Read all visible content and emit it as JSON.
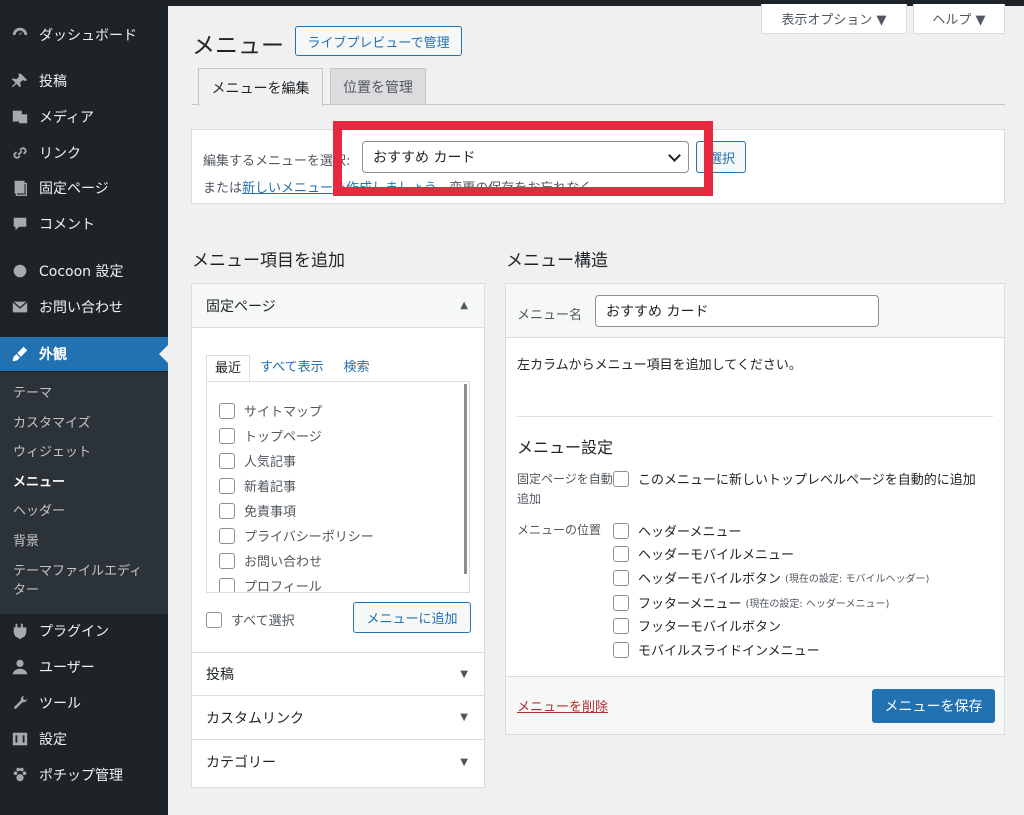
{
  "sidebar": {
    "items": [
      {
        "label": "ダッシュボード",
        "icon": "dashboard-icon"
      },
      {
        "label": "投稿",
        "icon": "pin-icon"
      },
      {
        "label": "メディア",
        "icon": "media-icon"
      },
      {
        "label": "リンク",
        "icon": "link-icon"
      },
      {
        "label": "固定ページ",
        "icon": "pages-icon"
      },
      {
        "label": "コメント",
        "icon": "comment-icon"
      },
      {
        "label": "Cocoon 設定",
        "icon": "cocoon-icon"
      },
      {
        "label": "お問い合わせ",
        "icon": "mail-icon"
      },
      {
        "label": "外観",
        "icon": "appearance-icon"
      },
      {
        "label": "プラグイン",
        "icon": "plugin-icon"
      },
      {
        "label": "ユーザー",
        "icon": "user-icon"
      },
      {
        "label": "ツール",
        "icon": "wrench-icon"
      },
      {
        "label": "設定",
        "icon": "settings-icon"
      },
      {
        "label": "ポチップ管理",
        "icon": "paw-icon"
      }
    ],
    "submenu": [
      "テーマ",
      "カスタマイズ",
      "ウィジェット",
      "メニュー",
      "ヘッダー",
      "背景",
      "テーマファイルエディ",
      "ター"
    ]
  },
  "screen_options": {
    "display": "表示オプション ▼",
    "help": "ヘルプ ▼"
  },
  "header": {
    "title": "メニュー",
    "live_preview": "ライブプレビューで管理"
  },
  "tabs": {
    "edit": "メニューを編集",
    "locations": "位置を管理"
  },
  "select_bar": {
    "label": "編集するメニューを選択:",
    "selected": "おすすめ カード",
    "select_button": "選択",
    "or_text": "または",
    "new_link": "新しいメニューを作成しましょう。",
    "save_note": "変更の保存をお忘れなく。"
  },
  "add_items": {
    "heading": "メニュー項目を追加",
    "pages_title": "固定ページ",
    "inner_tabs": [
      "最近",
      "すべて表示",
      "検索"
    ],
    "pages": [
      "サイトマップ",
      "トップページ",
      "人気記事",
      "新着記事",
      "免責事項",
      "プライバシーポリシー",
      "お問い合わせ",
      "プロフィール"
    ],
    "select_all": "すべて選択",
    "add_button": "メニューに追加",
    "sections": [
      "投稿",
      "カスタムリンク",
      "カテゴリー"
    ]
  },
  "structure": {
    "heading": "メニュー構造",
    "name_label": "メニュー名",
    "name_value": "おすすめ カード",
    "instruction": "左カラムからメニュー項目を追加してください。",
    "settings_heading": "メニュー設定",
    "auto_add_label": "固定ページを自動追加",
    "auto_add_text": "このメニューに新しいトップレベルページを自動的に追加",
    "location_label": "メニューの位置",
    "locations": [
      {
        "name": "ヘッダーメニュー",
        "note": ""
      },
      {
        "name": "ヘッダーモバイルメニュー",
        "note": ""
      },
      {
        "name": "ヘッダーモバイルボタン",
        "note": "(現在の設定: モバイルヘッダー)"
      },
      {
        "name": "フッターメニュー",
        "note": "(現在の設定: ヘッダーメニュー)"
      },
      {
        "name": "フッターモバイルボタン",
        "note": ""
      },
      {
        "name": "モバイルスライドインメニュー",
        "note": ""
      }
    ],
    "delete": "メニューを削除",
    "save": "メニューを保存"
  }
}
